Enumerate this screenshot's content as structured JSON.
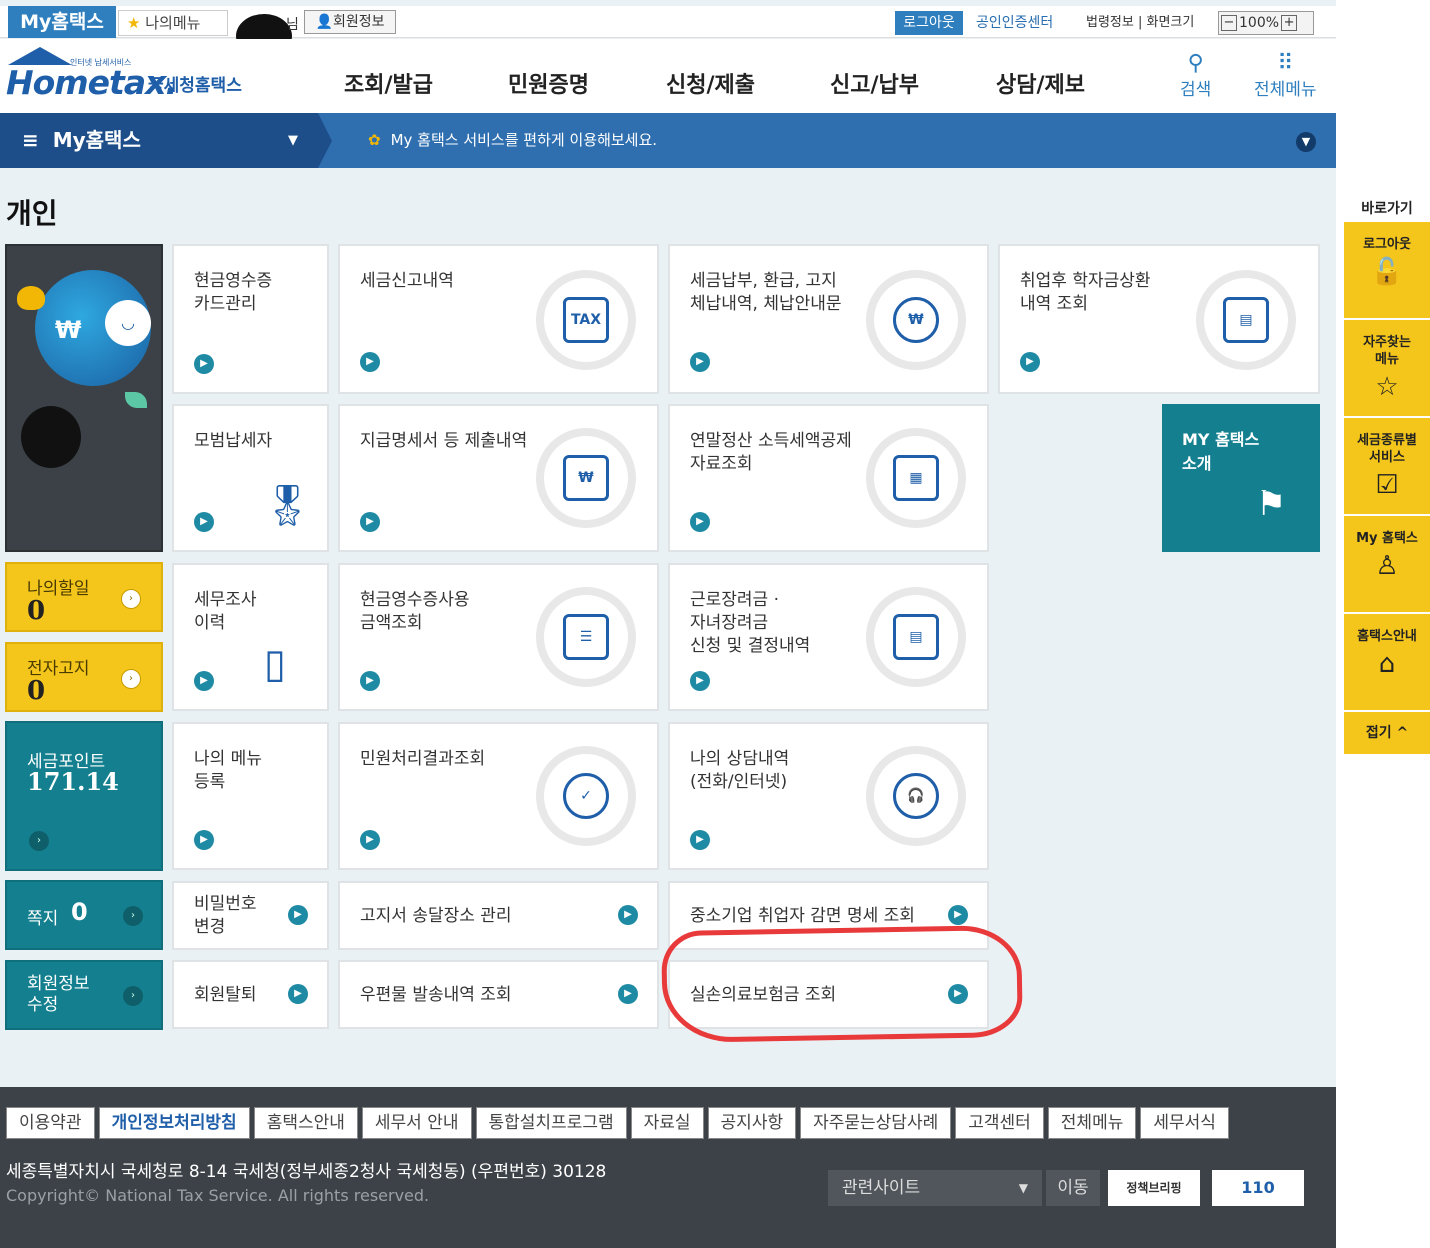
{
  "topbar": {
    "my_hometax": "My홈택스",
    "my_menu": "나의메뉴",
    "name_suffix": "님",
    "member_info": "회원정보",
    "logout": "로그아웃",
    "cert_center": "공인인증센터",
    "law_info": "법령정보",
    "screen_size": "화면크기",
    "zoom": "100%",
    "zoom_minus": "−",
    "zoom_plus": "+"
  },
  "gnb": {
    "logo_tagline": "인터넷 납세서비스",
    "logo": "Hometax.",
    "logo_kr": "국세청홈택스",
    "menus": [
      "조회/발급",
      "민원증명",
      "신청/제출",
      "신고/납부",
      "상담/제보"
    ],
    "search": "검색",
    "all_menu": "전체메뉴"
  },
  "sub": {
    "title": "My홈택스",
    "message": "My 홈택스 서비스를 편하게 이용해보세요."
  },
  "page_title": "개인",
  "left": {
    "discount_label": "나의할일",
    "discount_value": "0",
    "bill_label": "전자고지",
    "bill_value": "0",
    "point_label": "세금포인트",
    "point_value": "171.14",
    "note_label": "쪽지",
    "note_value": "0",
    "edit_label": "회원정보\n수정"
  },
  "cards": [
    "현금영수증\n카드관리",
    "세금신고내역",
    "세금납부, 환급, 고지\n체납내역, 체납안내문",
    "취업후 학자금상환\n내역 조회",
    "모범납세자",
    "지급명세서 등 제출내역",
    "연말정산 소득세액공제\n자료조회",
    "세무조사\n이력",
    "현금영수증사용\n금액조회",
    "근로장려금 ·\n자녀장려금\n신청 및 결정내역",
    "나의 메뉴\n등록",
    "민원처리결과조회",
    "나의 상담내역\n(전화/인터넷)",
    "비밀번호\n변경",
    "고지서 송달장소 관리",
    "중소기업 취업자 감면 명세 조회",
    "회원탈퇴",
    "우편물 발송내역 조회",
    "실손의료보험금 조회"
  ],
  "icons": {
    "tax": "TAX",
    "won": "₩"
  },
  "my_hometax_intro": "MY 홈택스\n소개",
  "quick": {
    "title": "바로가기",
    "items": [
      "로그아웃",
      "자주찾는\n메뉴",
      "세금종류별\n서비스",
      "My 홈택스",
      "홈택스안내"
    ],
    "fold": "접기 ^"
  },
  "footer": {
    "links": [
      "이용약관",
      "개인정보처리방침",
      "홈택스안내",
      "세무서 안내",
      "통합설치프로그램",
      "자료실",
      "공지사항",
      "자주묻는상담사례",
      "고객센터",
      "전체메뉴",
      "세무서식"
    ],
    "address": "세종특별자치시 국세청로 8-14 국세청(정부세종2청사 국세청동) (우편번호) 30128",
    "copyright": "Copyright© National Tax Service. All rights reserved.",
    "related": "관련사이트",
    "go": "이동",
    "banner1": "정책브리핑",
    "banner2": "110"
  }
}
